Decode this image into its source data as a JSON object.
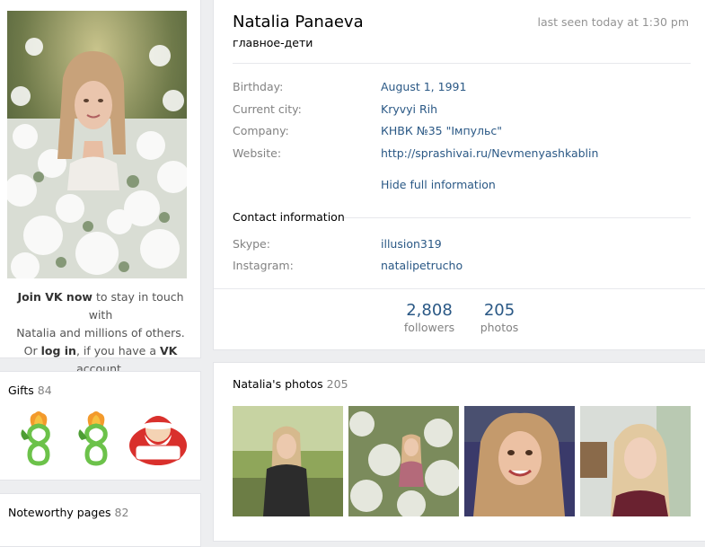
{
  "profile": {
    "name": "Natalia Panaeva",
    "status": "главное-дети",
    "last_seen": "last seen today at 1:30 pm"
  },
  "info": {
    "birthday_label": "Birthday:",
    "birthday_value": "August 1, 1991",
    "city_label": "Current city:",
    "city_value": "Kryvyi Rih",
    "company_label": "Company:",
    "company_value": "КНВК №35 \"Імпульс\"",
    "website_label": "Website:",
    "website_value": "http://sprashivai.ru/Nevmenyashkablin",
    "hide_full": "Hide full information"
  },
  "contact": {
    "heading": "Contact information",
    "skype_label": "Skype:",
    "skype_value": "illusion319",
    "instagram_label": "Instagram:",
    "instagram_value": "natalipetrucho"
  },
  "counters": {
    "followers_num": "2,808",
    "followers_label": "followers",
    "photos_num": "205",
    "photos_label": "photos"
  },
  "join": {
    "join_link": "Join VK now",
    "line1_rest": " to stay in touch with",
    "line2": "Natalia and millions of others.",
    "or": "Or ",
    "login_link": "log in",
    "line3_mid": ", if you have a ",
    "vk": "VK",
    "line3_end": " account."
  },
  "gifts": {
    "title": "Gifts",
    "count": "84",
    "items": [
      "figure-eight-tulip-icon",
      "figure-eight-tulip-icon",
      "santa-claus-icon"
    ]
  },
  "noteworthy": {
    "title": "Noteworthy pages",
    "count": "82"
  },
  "photos": {
    "title": "Natalia's photos",
    "count": "205"
  },
  "colors": {
    "link": "#2a5885",
    "muted": "#828282",
    "background": "#edeef0"
  }
}
